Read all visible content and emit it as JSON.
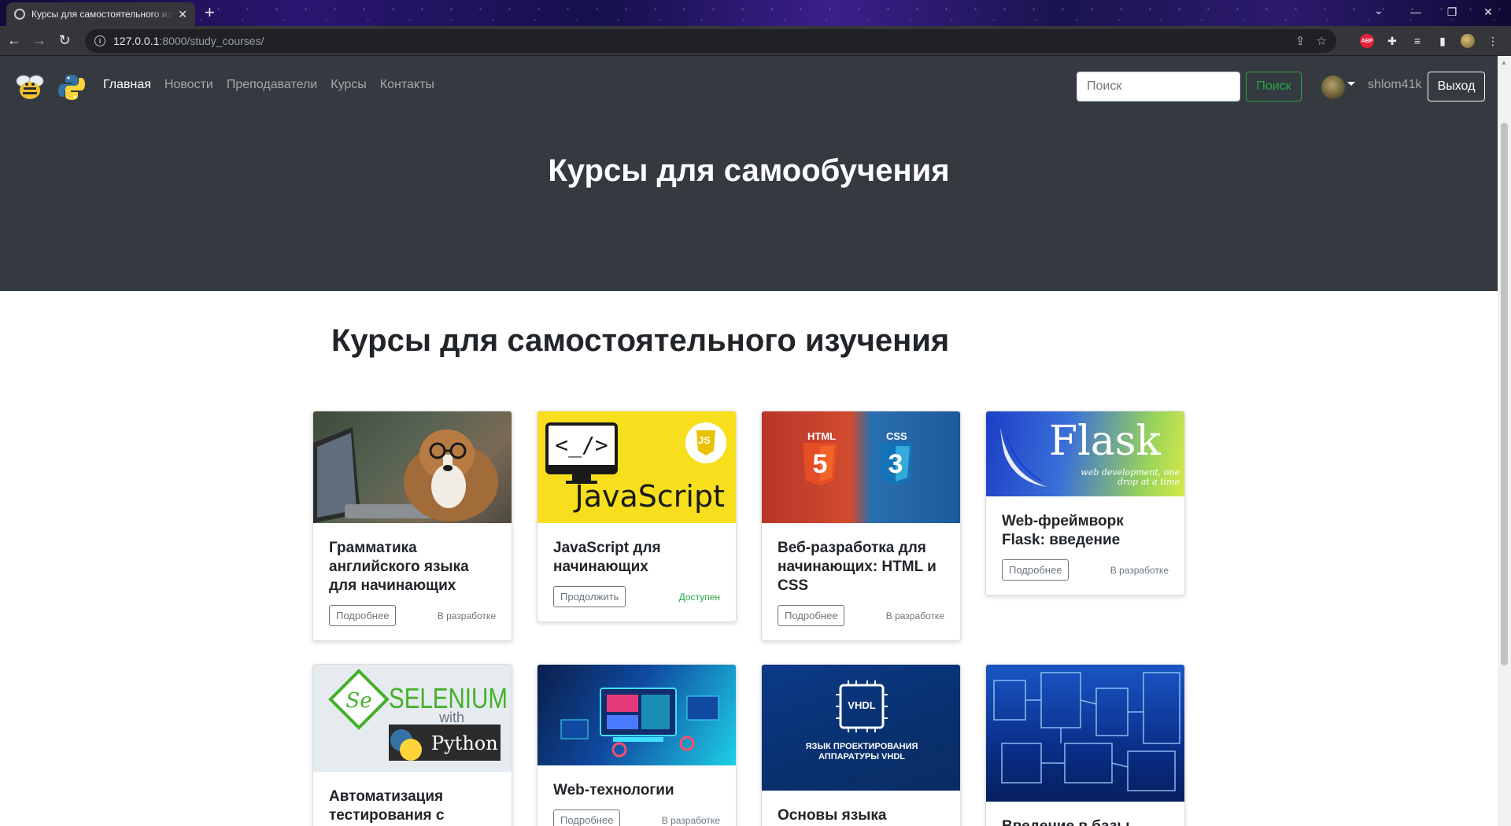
{
  "browser": {
    "tab_title": "Курсы для самостоятельного изучения",
    "url_host": "127.0.0.1",
    "url_rest": ":8000/study_courses/"
  },
  "nav": {
    "links": [
      "Главная",
      "Новости",
      "Преподаватели",
      "Курсы",
      "Контакты"
    ],
    "active_index": 0,
    "search_placeholder": "Поиск",
    "search_button": "Поиск",
    "username": "shlom41k",
    "logout": "Выход"
  },
  "hero": {
    "title": "Курсы для самообучения"
  },
  "section": {
    "title": "Курсы для самостоятельного изучения"
  },
  "cards": [
    {
      "title": "Грамматика английского языка для начинающих",
      "button": "Подробнее",
      "status": "В разработке"
    },
    {
      "title": "JavaScript для начинающих",
      "button": "Продолжить",
      "status": "Доступен",
      "image_text": "JavaScript",
      "badge": "JS"
    },
    {
      "title": "Веб-разработка для начинающих: HTML и CSS",
      "button": "Подробнее",
      "status": "В разработке",
      "image_labels": [
        "HTML",
        "CSS"
      ]
    },
    {
      "title": "Web-фреймворк Flask: введение",
      "button": "Подробнее",
      "status": "В разработке",
      "image_text": "Flask",
      "image_sub": "web development, one drop at a time"
    },
    {
      "title": "Автоматизация тестирования с",
      "image_text": "SELENIUM",
      "image_with": "with",
      "image_py": "Python"
    },
    {
      "title": "Web-технологии",
      "button": "Подробнее",
      "status": "В разработке"
    },
    {
      "title": "Основы языка",
      "image_chip": "VHDL",
      "image_caption": "ЯЗЫК ПРОЕКТИРОВАНИЯ АППАРАТУРЫ VHDL"
    },
    {
      "title": "Введение в базы"
    }
  ],
  "colors": {
    "navbar": "#343a40",
    "success": "#28a745",
    "secondary": "#6c757d"
  }
}
